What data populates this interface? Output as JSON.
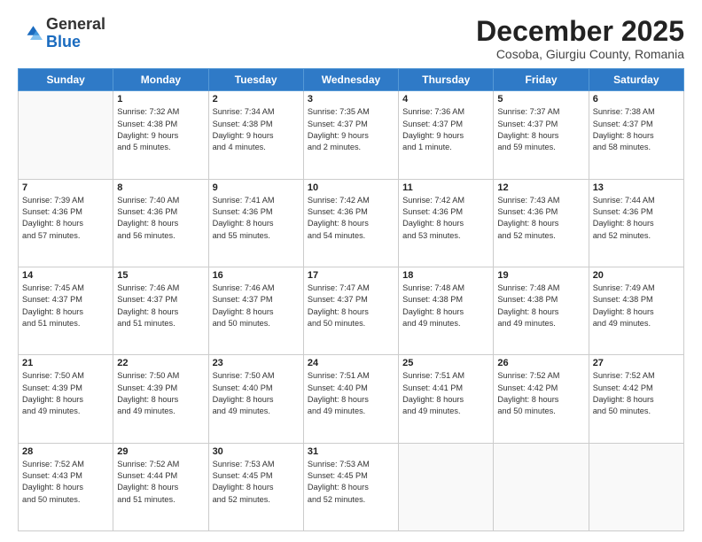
{
  "logo": {
    "general": "General",
    "blue": "Blue"
  },
  "header": {
    "month": "December 2025",
    "location": "Cosoba, Giurgiu County, Romania"
  },
  "weekdays": [
    "Sunday",
    "Monday",
    "Tuesday",
    "Wednesday",
    "Thursday",
    "Friday",
    "Saturday"
  ],
  "weeks": [
    [
      {
        "day": "",
        "info": ""
      },
      {
        "day": "1",
        "info": "Sunrise: 7:32 AM\nSunset: 4:38 PM\nDaylight: 9 hours\nand 5 minutes."
      },
      {
        "day": "2",
        "info": "Sunrise: 7:34 AM\nSunset: 4:38 PM\nDaylight: 9 hours\nand 4 minutes."
      },
      {
        "day": "3",
        "info": "Sunrise: 7:35 AM\nSunset: 4:37 PM\nDaylight: 9 hours\nand 2 minutes."
      },
      {
        "day": "4",
        "info": "Sunrise: 7:36 AM\nSunset: 4:37 PM\nDaylight: 9 hours\nand 1 minute."
      },
      {
        "day": "5",
        "info": "Sunrise: 7:37 AM\nSunset: 4:37 PM\nDaylight: 8 hours\nand 59 minutes."
      },
      {
        "day": "6",
        "info": "Sunrise: 7:38 AM\nSunset: 4:37 PM\nDaylight: 8 hours\nand 58 minutes."
      }
    ],
    [
      {
        "day": "7",
        "info": "Sunrise: 7:39 AM\nSunset: 4:36 PM\nDaylight: 8 hours\nand 57 minutes."
      },
      {
        "day": "8",
        "info": "Sunrise: 7:40 AM\nSunset: 4:36 PM\nDaylight: 8 hours\nand 56 minutes."
      },
      {
        "day": "9",
        "info": "Sunrise: 7:41 AM\nSunset: 4:36 PM\nDaylight: 8 hours\nand 55 minutes."
      },
      {
        "day": "10",
        "info": "Sunrise: 7:42 AM\nSunset: 4:36 PM\nDaylight: 8 hours\nand 54 minutes."
      },
      {
        "day": "11",
        "info": "Sunrise: 7:42 AM\nSunset: 4:36 PM\nDaylight: 8 hours\nand 53 minutes."
      },
      {
        "day": "12",
        "info": "Sunrise: 7:43 AM\nSunset: 4:36 PM\nDaylight: 8 hours\nand 52 minutes."
      },
      {
        "day": "13",
        "info": "Sunrise: 7:44 AM\nSunset: 4:36 PM\nDaylight: 8 hours\nand 52 minutes."
      }
    ],
    [
      {
        "day": "14",
        "info": "Sunrise: 7:45 AM\nSunset: 4:37 PM\nDaylight: 8 hours\nand 51 minutes."
      },
      {
        "day": "15",
        "info": "Sunrise: 7:46 AM\nSunset: 4:37 PM\nDaylight: 8 hours\nand 51 minutes."
      },
      {
        "day": "16",
        "info": "Sunrise: 7:46 AM\nSunset: 4:37 PM\nDaylight: 8 hours\nand 50 minutes."
      },
      {
        "day": "17",
        "info": "Sunrise: 7:47 AM\nSunset: 4:37 PM\nDaylight: 8 hours\nand 50 minutes."
      },
      {
        "day": "18",
        "info": "Sunrise: 7:48 AM\nSunset: 4:38 PM\nDaylight: 8 hours\nand 49 minutes."
      },
      {
        "day": "19",
        "info": "Sunrise: 7:48 AM\nSunset: 4:38 PM\nDaylight: 8 hours\nand 49 minutes."
      },
      {
        "day": "20",
        "info": "Sunrise: 7:49 AM\nSunset: 4:38 PM\nDaylight: 8 hours\nand 49 minutes."
      }
    ],
    [
      {
        "day": "21",
        "info": "Sunrise: 7:50 AM\nSunset: 4:39 PM\nDaylight: 8 hours\nand 49 minutes."
      },
      {
        "day": "22",
        "info": "Sunrise: 7:50 AM\nSunset: 4:39 PM\nDaylight: 8 hours\nand 49 minutes."
      },
      {
        "day": "23",
        "info": "Sunrise: 7:50 AM\nSunset: 4:40 PM\nDaylight: 8 hours\nand 49 minutes."
      },
      {
        "day": "24",
        "info": "Sunrise: 7:51 AM\nSunset: 4:40 PM\nDaylight: 8 hours\nand 49 minutes."
      },
      {
        "day": "25",
        "info": "Sunrise: 7:51 AM\nSunset: 4:41 PM\nDaylight: 8 hours\nand 49 minutes."
      },
      {
        "day": "26",
        "info": "Sunrise: 7:52 AM\nSunset: 4:42 PM\nDaylight: 8 hours\nand 50 minutes."
      },
      {
        "day": "27",
        "info": "Sunrise: 7:52 AM\nSunset: 4:42 PM\nDaylight: 8 hours\nand 50 minutes."
      }
    ],
    [
      {
        "day": "28",
        "info": "Sunrise: 7:52 AM\nSunset: 4:43 PM\nDaylight: 8 hours\nand 50 minutes."
      },
      {
        "day": "29",
        "info": "Sunrise: 7:52 AM\nSunset: 4:44 PM\nDaylight: 8 hours\nand 51 minutes."
      },
      {
        "day": "30",
        "info": "Sunrise: 7:53 AM\nSunset: 4:45 PM\nDaylight: 8 hours\nand 52 minutes."
      },
      {
        "day": "31",
        "info": "Sunrise: 7:53 AM\nSunset: 4:45 PM\nDaylight: 8 hours\nand 52 minutes."
      },
      {
        "day": "",
        "info": ""
      },
      {
        "day": "",
        "info": ""
      },
      {
        "day": "",
        "info": ""
      }
    ]
  ]
}
